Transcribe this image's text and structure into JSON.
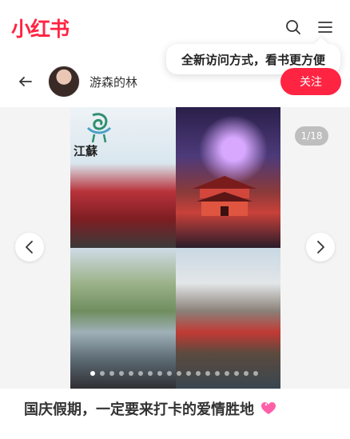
{
  "header": {
    "logo": "小红书",
    "search_icon": "search-icon",
    "menu_icon": "menu-icon"
  },
  "tooltip": {
    "text": "全新访问方式，看书更方便"
  },
  "author": {
    "name": "游森的林",
    "follow_label": "关注",
    "back_icon": "arrow-left-icon"
  },
  "carousel": {
    "page_counter": "1/18",
    "current_page": 1,
    "total_pages": 18,
    "prev_icon": "chevron-left-icon",
    "next_icon": "chevron-right-icon",
    "image_brand_text": "江蘇"
  },
  "note": {
    "title": "国庆假期，一定要来打卡的爱情胜地",
    "emoji_icon": "sparkling-heart-icon"
  },
  "colors": {
    "brand": "#ff2442",
    "text": "#333333",
    "carousel_bg": "#f4f4f4"
  }
}
